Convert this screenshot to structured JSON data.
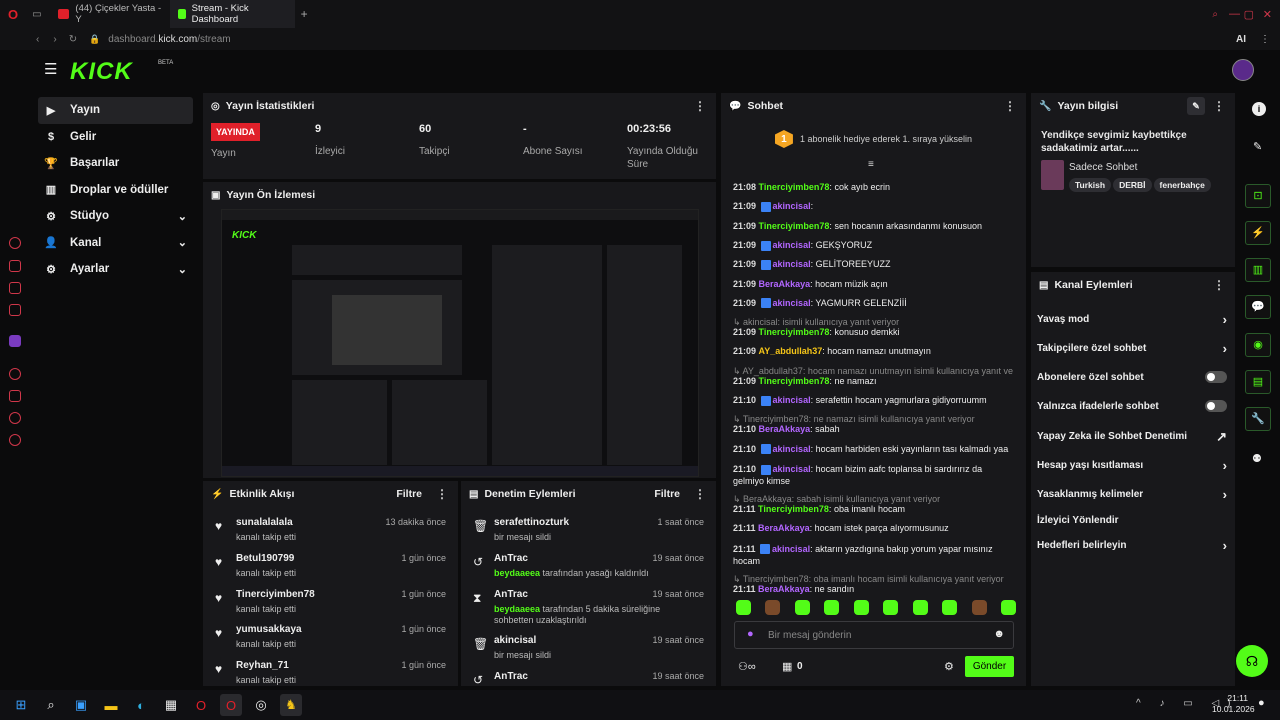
{
  "browser": {
    "tabs": [
      {
        "label": "(44) Çiçekler Yasta - Y",
        "icon_color": "#e0202a"
      },
      {
        "label": "Stream - Kick Dashboard",
        "icon_color": "#53fc18",
        "active": true
      }
    ],
    "url_prefix": "dashboard.",
    "url_domain": "kick.com",
    "url_path": "/stream",
    "ai_label": "AI"
  },
  "app": {
    "logo": "KICK",
    "beta": "BETA"
  },
  "nav": [
    {
      "label": "Yayın",
      "icon": "video-icon",
      "active": true
    },
    {
      "label": "Gelir",
      "icon": "money-icon"
    },
    {
      "label": "Başarılar",
      "icon": "trophy-icon"
    },
    {
      "label": "Droplar ve ödüller",
      "icon": "gift-icon"
    },
    {
      "label": "Stüdyo",
      "icon": "gear-icon",
      "expandable": true
    },
    {
      "label": "Kanal",
      "icon": "user-icon",
      "expandable": true
    },
    {
      "label": "Ayarlar",
      "icon": "settings-icon",
      "expandable": true
    }
  ],
  "stats": {
    "title": "Yayın İstatistikleri",
    "live_badge": "YAYINDA",
    "items": [
      {
        "value": "",
        "label": "Yayın"
      },
      {
        "value": "9",
        "label": "İzleyici"
      },
      {
        "value": "60",
        "label": "Takipçi"
      },
      {
        "value": "-",
        "label": "Abone Sayısı"
      },
      {
        "value": "00:23:56",
        "label": "Yayında Olduğu Süre"
      }
    ]
  },
  "preview": {
    "title": "Yayın Ön İzlemesi"
  },
  "activity": {
    "title": "Etkinlik Akışı",
    "filter": "Filtre",
    "items": [
      {
        "name": "sunalalalala",
        "sub": "kanalı takip etti",
        "time": "13 dakika önce"
      },
      {
        "name": "Betul190799",
        "sub": "kanalı takip etti",
        "time": "1 gün önce"
      },
      {
        "name": "Tinerciyimben78",
        "sub": "kanalı takip etti",
        "time": "1 gün önce"
      },
      {
        "name": "yumusakkaya",
        "sub": "kanalı takip etti",
        "time": "1 gün önce"
      },
      {
        "name": "Reyhan_71",
        "sub": "kanalı takip etti",
        "time": "1 gün önce"
      }
    ]
  },
  "moderation": {
    "title": "Denetim Eylemleri",
    "filter": "Filtre",
    "items": [
      {
        "name": "serafettinozturk",
        "actor": "",
        "sub": "bir mesajı sildi",
        "time": "1 saat önce",
        "icon": "trash-icon"
      },
      {
        "name": "AnTrac",
        "actor": "beydaaeea",
        "sub": " tarafından yasağı kaldırıldı",
        "time": "19 saat önce",
        "icon": "undo-icon"
      },
      {
        "name": "AnTrac",
        "actor": "beydaaeea",
        "sub": " tarafından 5 dakika süreliğine sohbetten uzaklaştırıldı",
        "time": "19 saat önce",
        "icon": "hourglass-icon"
      },
      {
        "name": "akincisal",
        "actor": "",
        "sub": "bir mesajı sildi",
        "time": "19 saat önce",
        "icon": "trash-icon"
      },
      {
        "name": "AnTrac",
        "actor": "",
        "sub": "",
        "time": "19 saat önce",
        "icon": "undo-icon"
      }
    ]
  },
  "chat": {
    "title": "Sohbet",
    "pinned": "1 abonelik hediye ederek 1. sıraya yükselin",
    "messages": [
      {
        "time": "21:08",
        "user": "Tinerciyimben78",
        "color": "#53fc18",
        "text": "cok ayıb ecrin",
        "badge": false
      },
      {
        "time": "21:09",
        "user": "akincisal",
        "color": "#b266ff",
        "text": "",
        "badge": true
      },
      {
        "time": "21:09",
        "user": "Tinerciyimben78",
        "color": "#53fc18",
        "text": "sen hocanın arkasındanmı konusuon",
        "badge": false
      },
      {
        "time": "21:09",
        "user": "akincisal",
        "color": "#b266ff",
        "text": "GEKŞYORUZ",
        "badge": true
      },
      {
        "time": "21:09",
        "user": "akincisal",
        "color": "#b266ff",
        "text": "GELİTOREEYUZZ",
        "badge": true
      },
      {
        "time": "21:09",
        "user": "BeraAkkaya",
        "color": "#b266ff",
        "text": "hocam müzik açın",
        "badge": false
      },
      {
        "time": "21:09",
        "user": "akincisal",
        "color": "#b266ff",
        "text": "YAGMURR GELENZİİİ",
        "badge": true
      },
      {
        "reply": "akincisal: isimli kullanıcıya yanıt veriyor"
      },
      {
        "time": "21:09",
        "user": "Tinerciyimben78",
        "color": "#53fc18",
        "text": "konusuo demkki",
        "badge": false
      },
      {
        "time": "21:09",
        "user": "AY_abdullah37",
        "color": "#f5c518",
        "text": "hocam namazı unutmayın",
        "badge": false
      },
      {
        "reply": "AY_abdullah37: hocam namazı unutmayın isimli kullanıcıya yanıt ver..."
      },
      {
        "time": "21:09",
        "user": "Tinerciyimben78",
        "color": "#53fc18",
        "text": "ne namazı",
        "badge": false
      },
      {
        "time": "21:10",
        "user": "akincisal",
        "color": "#b266ff",
        "text": "serafettin hocam yagmurlara gidiyorruumm",
        "badge": true
      },
      {
        "reply": "Tinerciyimben78: ne namazı isimli kullanıcıya yanıt veriyor"
      },
      {
        "time": "21:10",
        "user": "BeraAkkaya",
        "color": "#b266ff",
        "text": "sabah",
        "badge": false
      },
      {
        "time": "21:10",
        "user": "akincisal",
        "color": "#b266ff",
        "text": "hocam harbiden eski yayınların tası kalmadı yaa",
        "badge": true
      },
      {
        "time": "21:10",
        "user": "akincisal",
        "color": "#b266ff",
        "text": "hocam bizim aafc toplansa bi sardırırız da gelmiyo kimse",
        "badge": true
      },
      {
        "reply": "BeraAkkaya: sabah isimli kullanıcıya yanıt veriyor"
      },
      {
        "time": "21:11",
        "user": "Tinerciyimben78",
        "color": "#53fc18",
        "text": "oba imanlı hocam",
        "badge": false
      },
      {
        "time": "21:11",
        "user": "BeraAkkaya",
        "color": "#b266ff",
        "text": "hocam istek parça alıyormusunuz",
        "badge": false
      },
      {
        "time": "21:11",
        "user": "akincisal",
        "color": "#b266ff",
        "text": "aktarın yazdıgına bakıp yorum yapar mısınız hocam",
        "badge": true
      },
      {
        "reply": "Tinerciyimben78: oba imanlı hocam isimli kullanıcıya yanıt veriyor"
      },
      {
        "time": "21:11",
        "user": "BeraAkkaya",
        "color": "#b266ff",
        "text": "ne sandın",
        "badge": false
      }
    ],
    "input_placeholder": "Bir mesaj gönderin",
    "points": "0",
    "send": "Gönder"
  },
  "info": {
    "title": "Yayın bilgisi",
    "stream_title": "Yendikçe sevgimiz kaybettikçe sadakatimiz artar......",
    "category": "Sadece Sohbet",
    "tags": [
      "Turkish",
      "DERBİ",
      "fenerbahçe"
    ]
  },
  "actions": {
    "title": "Kanal Eylemleri",
    "items": [
      {
        "label": "Yavaş mod",
        "type": "arrow"
      },
      {
        "label": "Takipçilere özel sohbet",
        "type": "arrow"
      },
      {
        "label": "Abonelere özel sohbet",
        "type": "toggle"
      },
      {
        "label": "Yalnızca ifadelerle sohbet",
        "type": "toggle"
      },
      {
        "label": "Yapay Zeka ile Sohbet Denetimi",
        "type": "external"
      },
      {
        "label": "Hesap yaşı kısıtlaması",
        "type": "arrow"
      },
      {
        "label": "Yasaklanmış kelimeler",
        "type": "arrow"
      },
      {
        "label": "İzleyici Yönlendir",
        "type": "none"
      },
      {
        "label": "Hedefleri belirleyin",
        "type": "arrow"
      }
    ]
  },
  "taskbar": {
    "time": "21:11",
    "date": "10.01.2026"
  }
}
